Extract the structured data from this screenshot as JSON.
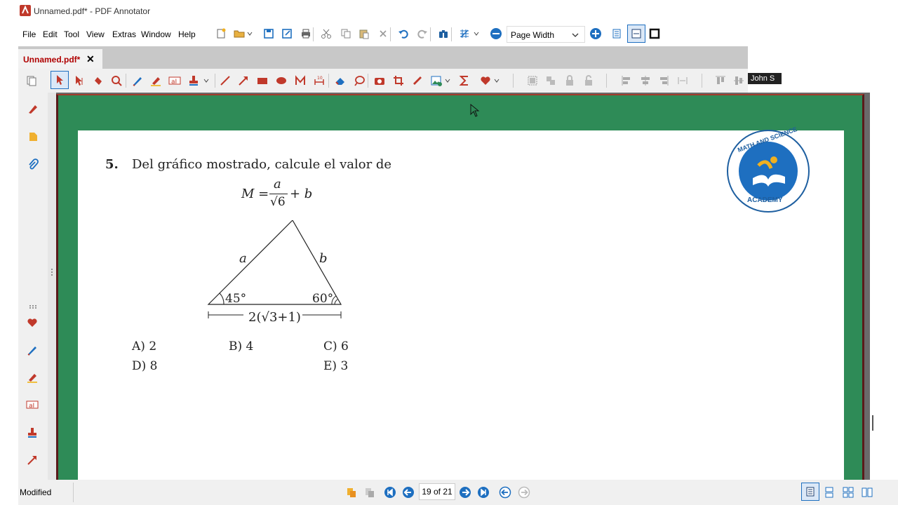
{
  "window": {
    "title": "Unnamed.pdf* - PDF Annotator"
  },
  "menu": [
    {
      "label": "File"
    },
    {
      "label": "Edit"
    },
    {
      "label": "Tool"
    },
    {
      "label": "View"
    },
    {
      "label": "Extras"
    },
    {
      "label": "Window"
    },
    {
      "label": "Help"
    }
  ],
  "toolbar": {
    "zoom_mode": "Page Width"
  },
  "tab": {
    "label": "Unnamed.pdf*",
    "close": "✕"
  },
  "toolbar2": {
    "user_label": "John S"
  },
  "problem": {
    "number": "5.",
    "statement": "Del gráfico mostrado, calcule el valor de",
    "formula_lhs": "M =",
    "formula_num": "a",
    "formula_den": "√6",
    "formula_tail": "+ b",
    "side_a": "a",
    "side_b": "b",
    "angle_left": "45°",
    "angle_right": "60°",
    "base_label": "2(√3+1)",
    "options": [
      {
        "label": "A) 2"
      },
      {
        "label": "B) 4"
      },
      {
        "label": "C) 6"
      },
      {
        "label": "D) 8"
      },
      {
        "label": "E) 3"
      }
    ]
  },
  "logo": {
    "top_text": "MATH AND SCIENCE",
    "bottom_text": "ACADEMY"
  },
  "status": {
    "state": "Modified",
    "page_indicator": "19 of 21"
  },
  "colors": {
    "accent_red": "#c0392b",
    "page_green": "#2e8b57",
    "nav_blue": "#1e6fc0"
  }
}
